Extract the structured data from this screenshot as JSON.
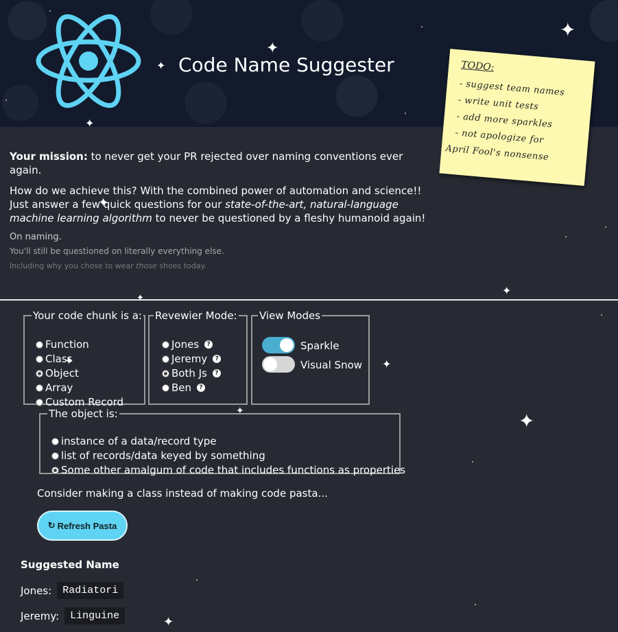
{
  "header": {
    "title": "Code Name Suggester"
  },
  "sticky_note": {
    "heading": "TODO:",
    "items": [
      "- suggest team names",
      "- write unit tests",
      "- add more sparkles",
      "- not apologize for",
      "April Fool's nonsense"
    ]
  },
  "intro": {
    "mission_label": "Your mission:",
    "mission_text": " to never get your PR rejected over naming conventions ever again.",
    "how_text_1": "How do we achieve this? With the combined power of automation and science!! Just answer a few quick questions for our ",
    "how_emph": "state-of-the-art, natural-language machine learning algorithm",
    "how_text_2": " to never be questioned by a fleshy humanoid again!",
    "fine_1": "On naming.",
    "fine_2": "You'll still be questioned on literally everything else.",
    "fine_3a": "Including why you chose to wear ",
    "fine_3b": "those",
    "fine_3c": " shoes today."
  },
  "code_chunk": {
    "legend": "Your code chunk is a:",
    "options": [
      "Function",
      "Class",
      "Object",
      "Array",
      "Custom Record"
    ],
    "selected": "Object"
  },
  "reviewer_mode": {
    "legend": "Revewier Mode:",
    "options": [
      "Jones",
      "Jeremy",
      "Both Js",
      "Ben"
    ],
    "selected": "Both Js",
    "help_glyph": "?"
  },
  "view_modes": {
    "legend": "View Modes",
    "toggles": [
      {
        "label": "Sparkle",
        "on": true
      },
      {
        "label": "Visual Snow",
        "on": false
      }
    ]
  },
  "object_is": {
    "legend": "The object is:",
    "options": [
      "instance of a data/record type",
      "list of records/data keyed by something",
      "Some other amalgum of code that includes functions as properties"
    ],
    "selected": "Some other amalgum of code that includes functions as properties"
  },
  "advice": "Consider making a class instead of making code pasta...",
  "refresh_button": {
    "icon": "↻",
    "label": "Refresh Pasta"
  },
  "suggested": {
    "title": "Suggested Name",
    "rows": [
      {
        "label": "Jones:",
        "name": "Radiatori"
      },
      {
        "label": "Jeremy:",
        "name": "Linguine"
      }
    ]
  },
  "colors": {
    "accent": "#5fd3f3",
    "header_bg": "#121a2c",
    "page_bg": "#272a33",
    "note_bg": "#fdf9b1",
    "toggle_on": "#4aaed0",
    "toggle_off": "#d6d6d6"
  }
}
